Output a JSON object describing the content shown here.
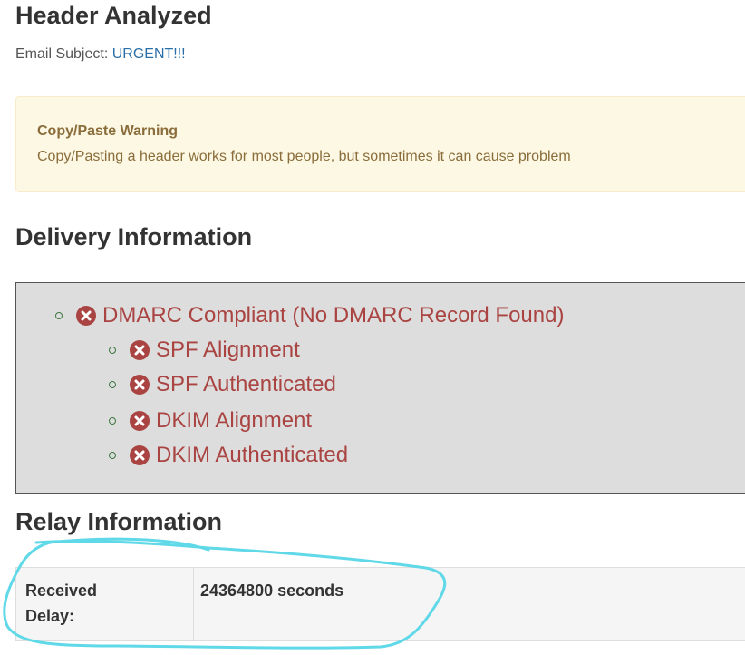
{
  "header": {
    "title": "Header Analyzed",
    "subject_label": "Email Subject:",
    "subject_value": "URGENT!!!"
  },
  "warning": {
    "title": "Copy/Paste Warning",
    "text": "Copy/Pasting a header works for most people, but sometimes it can cause problem"
  },
  "delivery": {
    "title": "Delivery Information",
    "items": [
      {
        "label": "DMARC Compliant (No DMARC Record Found)",
        "status": "fail",
        "level": 0
      },
      {
        "label": "SPF Alignment",
        "status": "fail",
        "level": 1
      },
      {
        "label": "SPF Authenticated",
        "status": "fail",
        "level": 1
      },
      {
        "label": "DKIM Alignment",
        "status": "fail",
        "level": 1
      },
      {
        "label": "DKIM Authenticated",
        "status": "fail",
        "level": 1
      }
    ]
  },
  "relay": {
    "title": "Relay Information",
    "row": {
      "label_line1": "Received",
      "label_line2": "Delay:",
      "value": "24364800 seconds"
    }
  },
  "colors": {
    "fail": "#a94442",
    "warning_bg": "#fcf8e3",
    "warning_text": "#8a6d3b",
    "delivery_bg": "#dddddd",
    "link": "#2a6fa8",
    "annotation": "#5fd8e8"
  },
  "icons": {
    "fail": "times-circle-icon",
    "bullet": "circle-bullet-icon"
  }
}
